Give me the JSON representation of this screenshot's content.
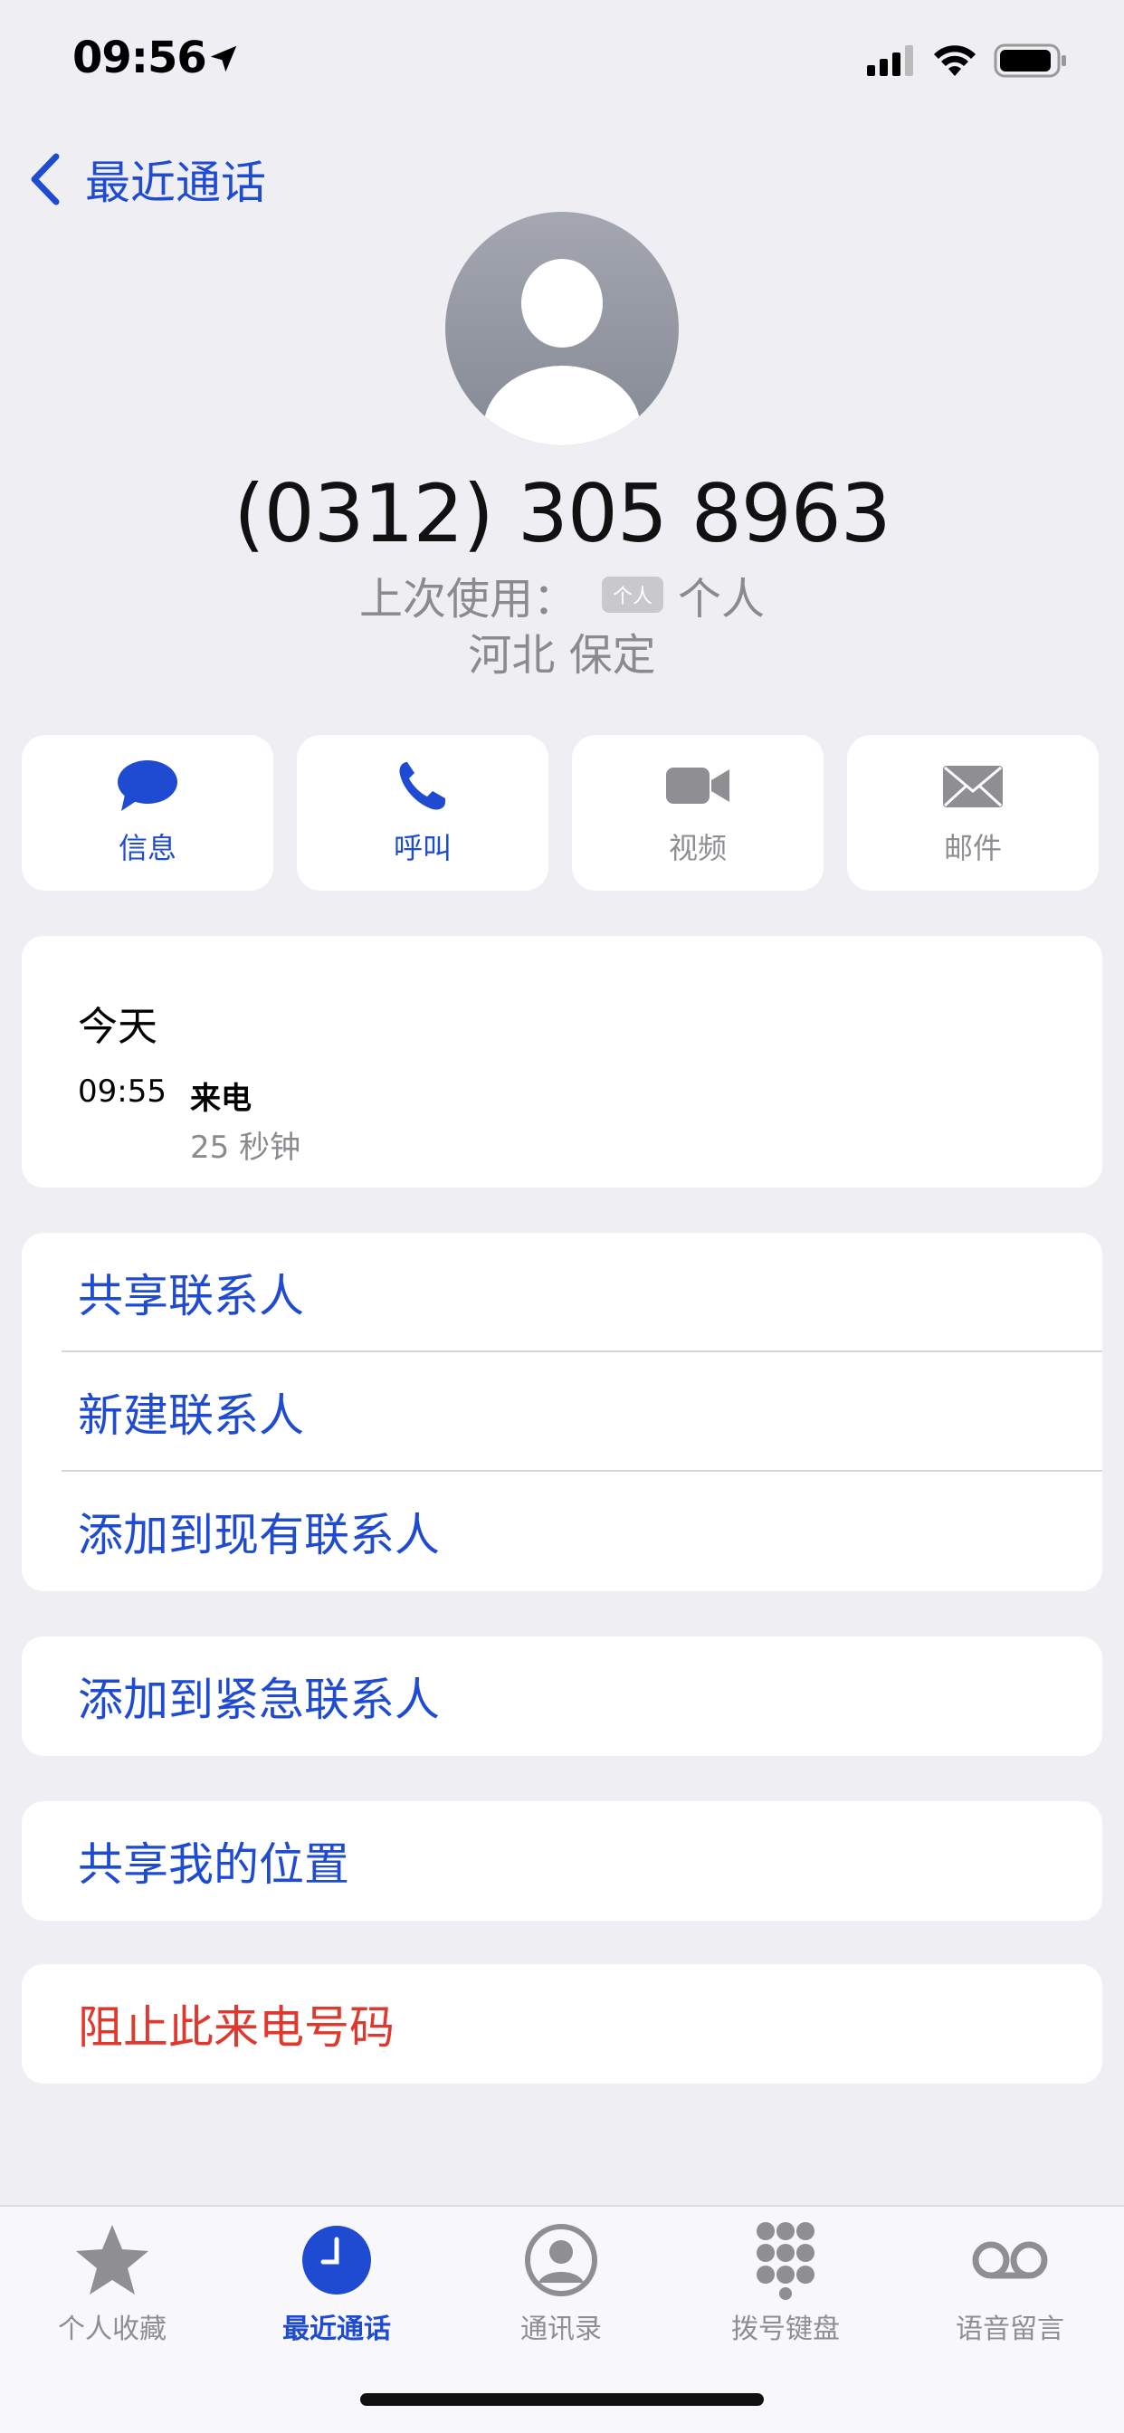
{
  "status_bar": {
    "time": "09:56"
  },
  "nav": {
    "back_label": "最近通话"
  },
  "contact": {
    "phone_number": "(0312) 305 8963",
    "last_used_label": "上次使用：",
    "tag_badge": "个人",
    "line_name": "个人",
    "location": "河北 保定"
  },
  "actions": [
    {
      "label": "信息",
      "icon": "message-icon",
      "enabled": true
    },
    {
      "label": "呼叫",
      "icon": "phone-icon",
      "enabled": true
    },
    {
      "label": "视频",
      "icon": "video-icon",
      "enabled": false
    },
    {
      "label": "邮件",
      "icon": "mail-icon",
      "enabled": false
    }
  ],
  "call_log": {
    "day": "今天",
    "entries": [
      {
        "time": "09:55",
        "type": "来电",
        "duration": "25 秒钟"
      }
    ]
  },
  "menu_group_1": [
    "共享联系人",
    "新建联系人",
    "添加到现有联系人"
  ],
  "emergency": "添加到紧急联系人",
  "share_location": "共享我的位置",
  "block": "阻止此来电号码",
  "tabs": [
    {
      "label": "个人收藏",
      "icon": "star-icon",
      "active": false
    },
    {
      "label": "最近通话",
      "icon": "clock-icon",
      "active": true
    },
    {
      "label": "通讯录",
      "icon": "contacts-icon",
      "active": false
    },
    {
      "label": "拨号键盘",
      "icon": "keypad-icon",
      "active": false
    },
    {
      "label": "语音留言",
      "icon": "voicemail-icon",
      "active": false
    }
  ],
  "colors": {
    "accent": "#1e4bd2",
    "danger": "#e0382c",
    "background": "#eeeef3",
    "disabled": "#8e8e93"
  }
}
